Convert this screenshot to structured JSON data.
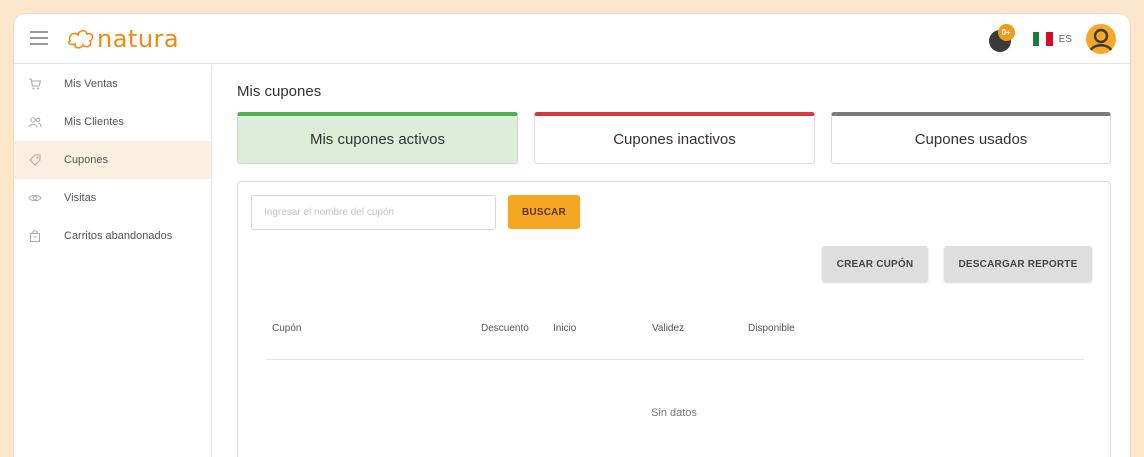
{
  "header": {
    "brand": "natura",
    "points_badge": "0+",
    "language": "ES",
    "colors": {
      "brand": "#f28a12",
      "avatar": "#f9a825",
      "badge": "#f29a1e"
    }
  },
  "sidebar": {
    "items": [
      {
        "label": "Mis Ventas",
        "icon": "cart-icon",
        "active": false
      },
      {
        "label": "Mis Clientes",
        "icon": "users-icon",
        "active": false
      },
      {
        "label": "Cupones",
        "icon": "tag-icon",
        "active": true
      },
      {
        "label": "Visitas",
        "icon": "eye-icon",
        "active": false
      },
      {
        "label": "Carritos abandonados",
        "icon": "bag-icon",
        "active": false
      }
    ]
  },
  "main": {
    "title": "Mis cupones",
    "tabs": [
      {
        "label": "Mis cupones activos",
        "color": "#4caf50",
        "active": true
      },
      {
        "label": "Cupones inactivos",
        "color": "#d9373a",
        "active": false
      },
      {
        "label": "Cupones usados",
        "color": "#7a7a7a",
        "active": false
      }
    ],
    "search": {
      "placeholder": "Ingresar el nombre del cupón",
      "value": "",
      "button_label": "BUSCAR"
    },
    "actions": {
      "create_label": "CREAR CUPÓN",
      "report_label": "DESCARGAR REPORTE"
    },
    "table": {
      "columns": [
        "Cupón",
        "Descuento",
        "Inicio",
        "Validez",
        "Disponible"
      ],
      "rows": [],
      "empty_text": "Sin datos"
    }
  }
}
